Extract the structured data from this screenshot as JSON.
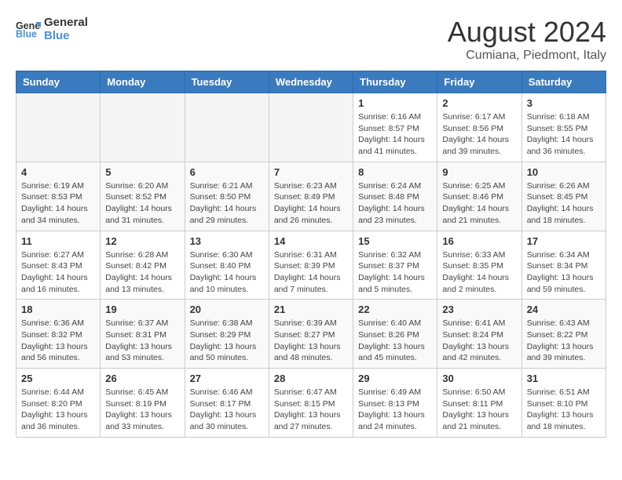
{
  "logo": {
    "line1": "General",
    "line2": "Blue"
  },
  "title": "August 2024",
  "location": "Cumiana, Piedmont, Italy",
  "days_of_week": [
    "Sunday",
    "Monday",
    "Tuesday",
    "Wednesday",
    "Thursday",
    "Friday",
    "Saturday"
  ],
  "weeks": [
    [
      {
        "day": "",
        "info": ""
      },
      {
        "day": "",
        "info": ""
      },
      {
        "day": "",
        "info": ""
      },
      {
        "day": "",
        "info": ""
      },
      {
        "day": "1",
        "info": "Sunrise: 6:16 AM\nSunset: 8:57 PM\nDaylight: 14 hours\nand 41 minutes."
      },
      {
        "day": "2",
        "info": "Sunrise: 6:17 AM\nSunset: 8:56 PM\nDaylight: 14 hours\nand 39 minutes."
      },
      {
        "day": "3",
        "info": "Sunrise: 6:18 AM\nSunset: 8:55 PM\nDaylight: 14 hours\nand 36 minutes."
      }
    ],
    [
      {
        "day": "4",
        "info": "Sunrise: 6:19 AM\nSunset: 8:53 PM\nDaylight: 14 hours\nand 34 minutes."
      },
      {
        "day": "5",
        "info": "Sunrise: 6:20 AM\nSunset: 8:52 PM\nDaylight: 14 hours\nand 31 minutes."
      },
      {
        "day": "6",
        "info": "Sunrise: 6:21 AM\nSunset: 8:50 PM\nDaylight: 14 hours\nand 29 minutes."
      },
      {
        "day": "7",
        "info": "Sunrise: 6:23 AM\nSunset: 8:49 PM\nDaylight: 14 hours\nand 26 minutes."
      },
      {
        "day": "8",
        "info": "Sunrise: 6:24 AM\nSunset: 8:48 PM\nDaylight: 14 hours\nand 23 minutes."
      },
      {
        "day": "9",
        "info": "Sunrise: 6:25 AM\nSunset: 8:46 PM\nDaylight: 14 hours\nand 21 minutes."
      },
      {
        "day": "10",
        "info": "Sunrise: 6:26 AM\nSunset: 8:45 PM\nDaylight: 14 hours\nand 18 minutes."
      }
    ],
    [
      {
        "day": "11",
        "info": "Sunrise: 6:27 AM\nSunset: 8:43 PM\nDaylight: 14 hours\nand 16 minutes."
      },
      {
        "day": "12",
        "info": "Sunrise: 6:28 AM\nSunset: 8:42 PM\nDaylight: 14 hours\nand 13 minutes."
      },
      {
        "day": "13",
        "info": "Sunrise: 6:30 AM\nSunset: 8:40 PM\nDaylight: 14 hours\nand 10 minutes."
      },
      {
        "day": "14",
        "info": "Sunrise: 6:31 AM\nSunset: 8:39 PM\nDaylight: 14 hours\nand 7 minutes."
      },
      {
        "day": "15",
        "info": "Sunrise: 6:32 AM\nSunset: 8:37 PM\nDaylight: 14 hours\nand 5 minutes."
      },
      {
        "day": "16",
        "info": "Sunrise: 6:33 AM\nSunset: 8:35 PM\nDaylight: 14 hours\nand 2 minutes."
      },
      {
        "day": "17",
        "info": "Sunrise: 6:34 AM\nSunset: 8:34 PM\nDaylight: 13 hours\nand 59 minutes."
      }
    ],
    [
      {
        "day": "18",
        "info": "Sunrise: 6:36 AM\nSunset: 8:32 PM\nDaylight: 13 hours\nand 56 minutes."
      },
      {
        "day": "19",
        "info": "Sunrise: 6:37 AM\nSunset: 8:31 PM\nDaylight: 13 hours\nand 53 minutes."
      },
      {
        "day": "20",
        "info": "Sunrise: 6:38 AM\nSunset: 8:29 PM\nDaylight: 13 hours\nand 50 minutes."
      },
      {
        "day": "21",
        "info": "Sunrise: 6:39 AM\nSunset: 8:27 PM\nDaylight: 13 hours\nand 48 minutes."
      },
      {
        "day": "22",
        "info": "Sunrise: 6:40 AM\nSunset: 8:26 PM\nDaylight: 13 hours\nand 45 minutes."
      },
      {
        "day": "23",
        "info": "Sunrise: 6:41 AM\nSunset: 8:24 PM\nDaylight: 13 hours\nand 42 minutes."
      },
      {
        "day": "24",
        "info": "Sunrise: 6:43 AM\nSunset: 8:22 PM\nDaylight: 13 hours\nand 39 minutes."
      }
    ],
    [
      {
        "day": "25",
        "info": "Sunrise: 6:44 AM\nSunset: 8:20 PM\nDaylight: 13 hours\nand 36 minutes."
      },
      {
        "day": "26",
        "info": "Sunrise: 6:45 AM\nSunset: 8:19 PM\nDaylight: 13 hours\nand 33 minutes."
      },
      {
        "day": "27",
        "info": "Sunrise: 6:46 AM\nSunset: 8:17 PM\nDaylight: 13 hours\nand 30 minutes."
      },
      {
        "day": "28",
        "info": "Sunrise: 6:47 AM\nSunset: 8:15 PM\nDaylight: 13 hours\nand 27 minutes."
      },
      {
        "day": "29",
        "info": "Sunrise: 6:49 AM\nSunset: 8:13 PM\nDaylight: 13 hours\nand 24 minutes."
      },
      {
        "day": "30",
        "info": "Sunrise: 6:50 AM\nSunset: 8:11 PM\nDaylight: 13 hours\nand 21 minutes."
      },
      {
        "day": "31",
        "info": "Sunrise: 6:51 AM\nSunset: 8:10 PM\nDaylight: 13 hours\nand 18 minutes."
      }
    ]
  ]
}
